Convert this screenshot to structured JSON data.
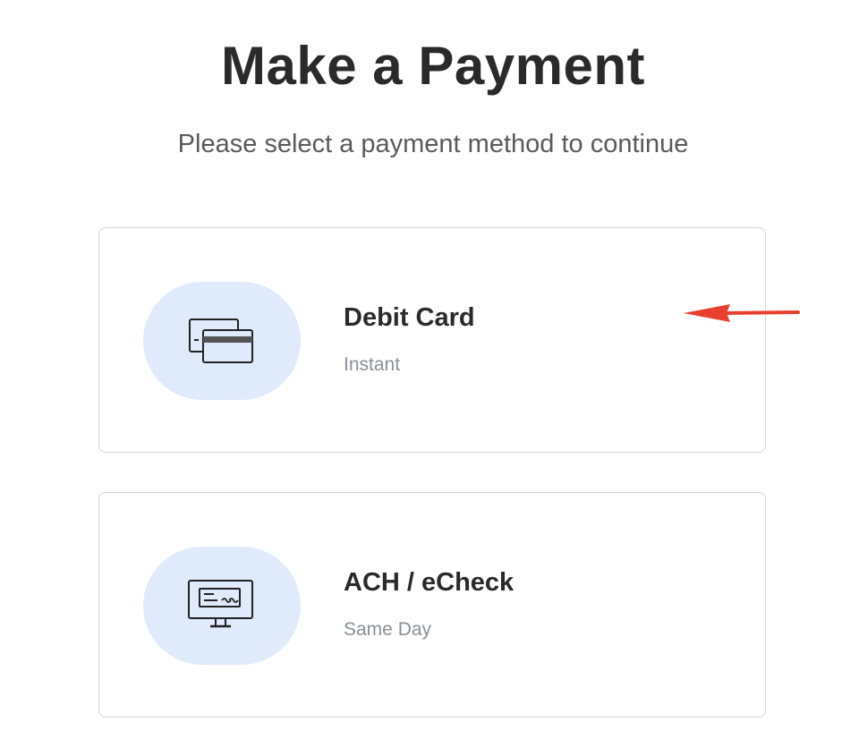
{
  "header": {
    "title": "Make a Payment",
    "subtitle": "Please select a payment method to continue"
  },
  "methods": [
    {
      "name": "Debit Card",
      "speed": "Instant",
      "icon": "credit-cards-icon"
    },
    {
      "name": "ACH / eCheck",
      "speed": "Same Day",
      "icon": "monitor-check-icon"
    }
  ],
  "colors": {
    "icon_background": "#dfeafb",
    "annotation_arrow": "#e8402f",
    "card_border": "#d4d4d4"
  }
}
